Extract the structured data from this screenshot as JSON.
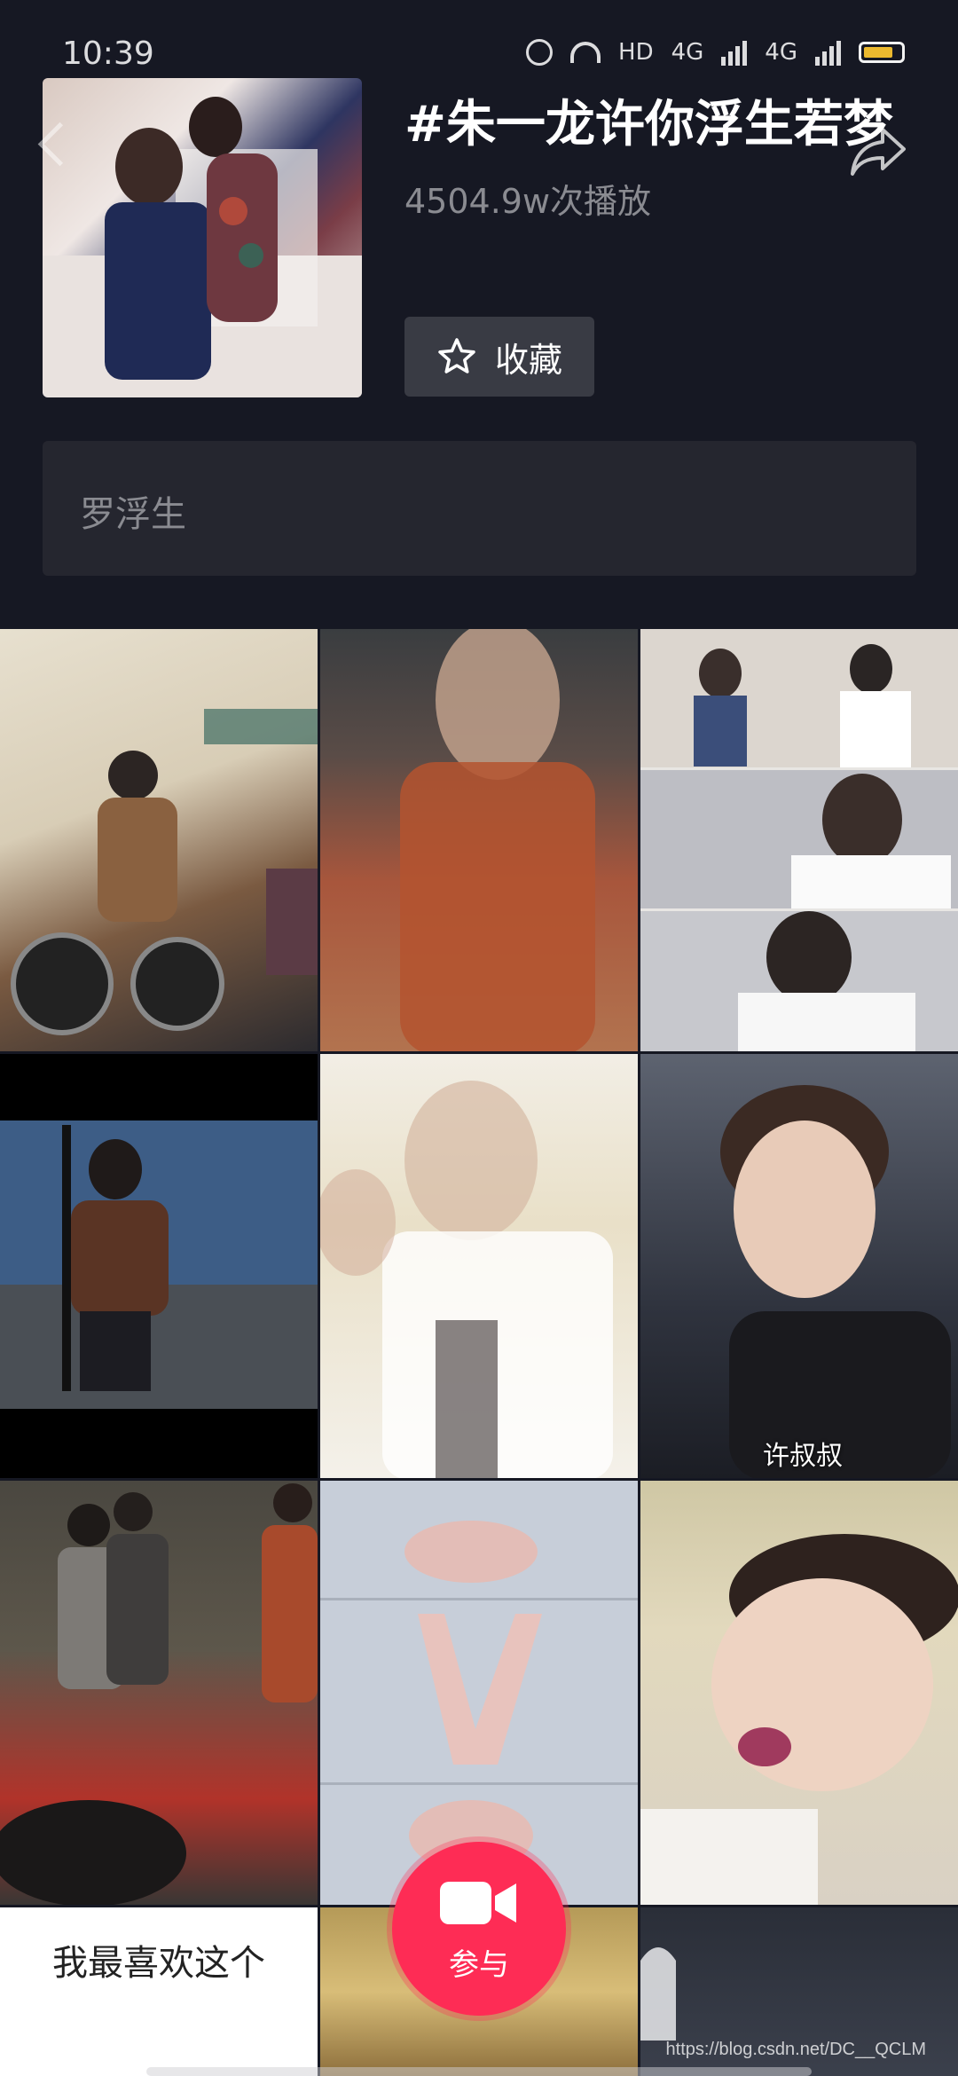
{
  "status_bar": {
    "time": "10:39",
    "hd_label": "HD",
    "net_label_1": "4G",
    "net_label_2": "4G",
    "battery_color": "#f7c230"
  },
  "topic": {
    "title": "#朱一龙许你浮生若梦",
    "play_count": "4504.9w次播放",
    "favorite_label": "收藏",
    "related_tag": "罗浮生"
  },
  "grid": {
    "tiles": [
      {
        "caption": ""
      },
      {
        "caption": ""
      },
      {
        "caption": ""
      },
      {
        "caption": ""
      },
      {
        "caption": ""
      },
      {
        "caption": "许叔叔"
      },
      {
        "caption": ""
      },
      {
        "caption": ""
      },
      {
        "caption": ""
      },
      {
        "caption": "我最喜欢这个"
      },
      {
        "caption": ""
      },
      {
        "caption": ""
      }
    ]
  },
  "join_button": {
    "label": "参与",
    "color": "#fe2c55"
  },
  "watermark": "https://blog.csdn.net/DC__QCLM",
  "icons": [
    "back-arrow-icon",
    "share-icon",
    "star-icon",
    "camera-icon",
    "alarm-icon",
    "wifi-icon",
    "signal-icon",
    "battery-icon"
  ]
}
